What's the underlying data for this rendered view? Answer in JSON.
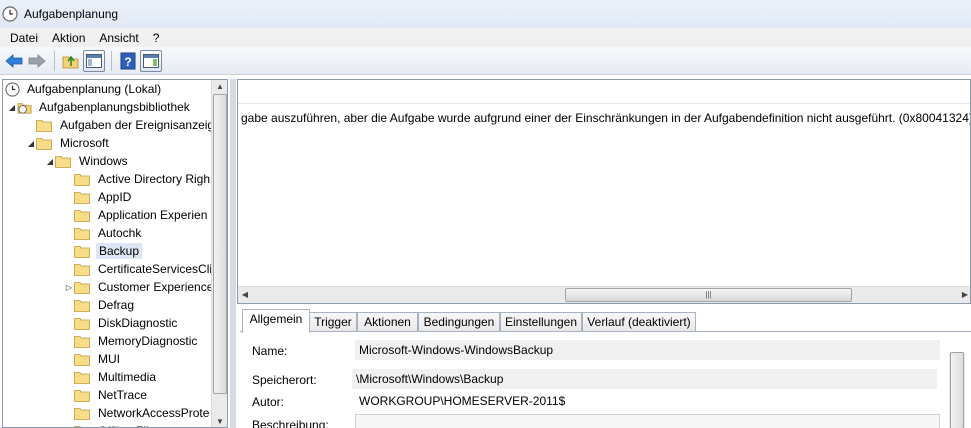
{
  "window": {
    "title": "Aufgabenplanung",
    "icon": "clock-icon"
  },
  "menu": [
    "Datei",
    "Aktion",
    "Ansicht",
    "?"
  ],
  "toolbar": {
    "buttons": [
      "back-arrow-icon",
      "forward-arrow-icon",
      "up-folder-icon",
      "show-hide-console-tree-icon",
      "help-icon",
      "show-hide-action-pane-icon"
    ]
  },
  "tree": {
    "root": "Aufgabenplanung (Lokal)",
    "library": "Aufgabenplanungsbibliothek",
    "items": [
      "Aufgaben der Ereignisanzeig",
      "Microsoft",
      "Windows",
      "Active Directory Righ",
      "AppID",
      "Application Experien",
      "Autochk",
      "Backup",
      "CertificateServicesCli",
      "Customer Experience",
      "Defrag",
      "DiskDiagnostic",
      "MemoryDiagnostic",
      "MUI",
      "Multimedia",
      "NetTrace",
      "NetworkAccessProte",
      "Offline Fil"
    ],
    "selected": "Backup"
  },
  "list": {
    "message": "gabe auszuführen, aber die Aufgabe wurde aufgrund einer der Einschränkungen in der Aufgabendefinition nicht ausgeführt. (0x80041324)"
  },
  "tabs": [
    "Allgemein",
    "Trigger",
    "Aktionen",
    "Bedingungen",
    "Einstellungen",
    "Verlauf (deaktiviert)"
  ],
  "general": {
    "name_label": "Name:",
    "name_value": "Microsoft-Windows-WindowsBackup",
    "location_label": "Speicherort:",
    "location_value": "\\Microsoft\\Windows\\Backup",
    "author_label": "Autor:",
    "author_value": "WORKGROUP\\HOMESERVER-2011$",
    "description_label": "Beschreibung:",
    "description_value": ""
  }
}
